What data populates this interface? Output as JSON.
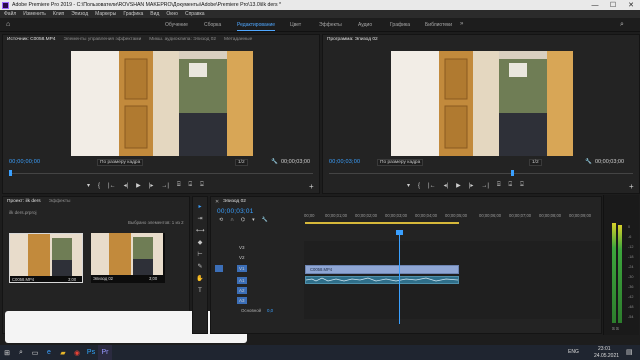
{
  "window": {
    "title": "Adobe Premiere Pro 2019 - C:\\Пользователи\\ROVSHAN MAKEPRO\\Документы\\Adobe\\Premiere Pro\\13.0\\ilk ders *",
    "min": "—",
    "max": "☐",
    "close": "✕"
  },
  "menu": [
    "Файл",
    "Изменить",
    "Клип",
    "Эпизод",
    "Маркеры",
    "Графика",
    "Вид",
    "Окно",
    "Справка"
  ],
  "workspaces": {
    "items": [
      "Обучение",
      "Сборка",
      "Редактирование",
      "Цвет",
      "Эффекты",
      "Аудио",
      "Графика",
      "Библиотеки"
    ],
    "active": "Редактирование",
    "more": "»"
  },
  "source": {
    "tabs": [
      "Источник: C0058.MP4",
      "Элементы управления эффектами",
      "Микш. аудиоклипа: Эпизод 02",
      "Метаданные"
    ],
    "tc_left": "00;00;00;00",
    "fit": "По размеру кадра",
    "res": "1/2",
    "tc_right": "00;00;03;00"
  },
  "program": {
    "tabs": [
      "Программа: Эпизод 02"
    ],
    "tc_left": "00;00;03;00",
    "fit": "По размеру кадра",
    "res": "1/2",
    "tc_right": "00;00;03;00"
  },
  "transport": [
    "▾",
    "{",
    "|←",
    "◂|",
    "▶",
    "|▸",
    "→|",
    "⌸",
    "⌹",
    "⌺"
  ],
  "project": {
    "tabs": [
      "Проект: ilk ders",
      "Эффекты"
    ],
    "path": "ilk ders.prproj",
    "selected_info": "Выбрано элементов: 1 из 2",
    "items": [
      {
        "name": "C0058.MP4",
        "dur": "3;00"
      },
      {
        "name": "Эпизод 02",
        "dur": "3;00"
      }
    ]
  },
  "tools": [
    "▸",
    "⇥",
    "⟷",
    "◆",
    "⊢",
    "✎",
    "✋",
    "T"
  ],
  "timeline": {
    "tab": "Эпизод 02",
    "tc": "00;00;03;01",
    "ruler": [
      "00;00",
      "00;00;01;00",
      "00;00;02;00",
      "00;00;03;00",
      "00;00;04;00",
      "00;00;05;00",
      "00;00;06;00",
      "00;00;07;00",
      "00;00;08;00",
      "00;00;09;00"
    ],
    "video_tracks": [
      "V3",
      "V2",
      "V1"
    ],
    "audio_tracks": [
      "A1",
      "A2",
      "A3"
    ],
    "clip_label": "C0058.MP4",
    "master": "Основной",
    "master_val": "0,0"
  },
  "meter": {
    "labels": [
      "0",
      "-6",
      "-12",
      "-18",
      "-24",
      "-30",
      "-36",
      "-42",
      "-48",
      "-54"
    ],
    "bottom": "S S"
  },
  "taskbar": {
    "lang": "ENG",
    "time": "23:01",
    "date": "24.05.2021"
  },
  "colors": {
    "accent": "#3aa0ff",
    "clip_video": "#8fa6d4",
    "clip_audio": "#2f6f8a"
  }
}
